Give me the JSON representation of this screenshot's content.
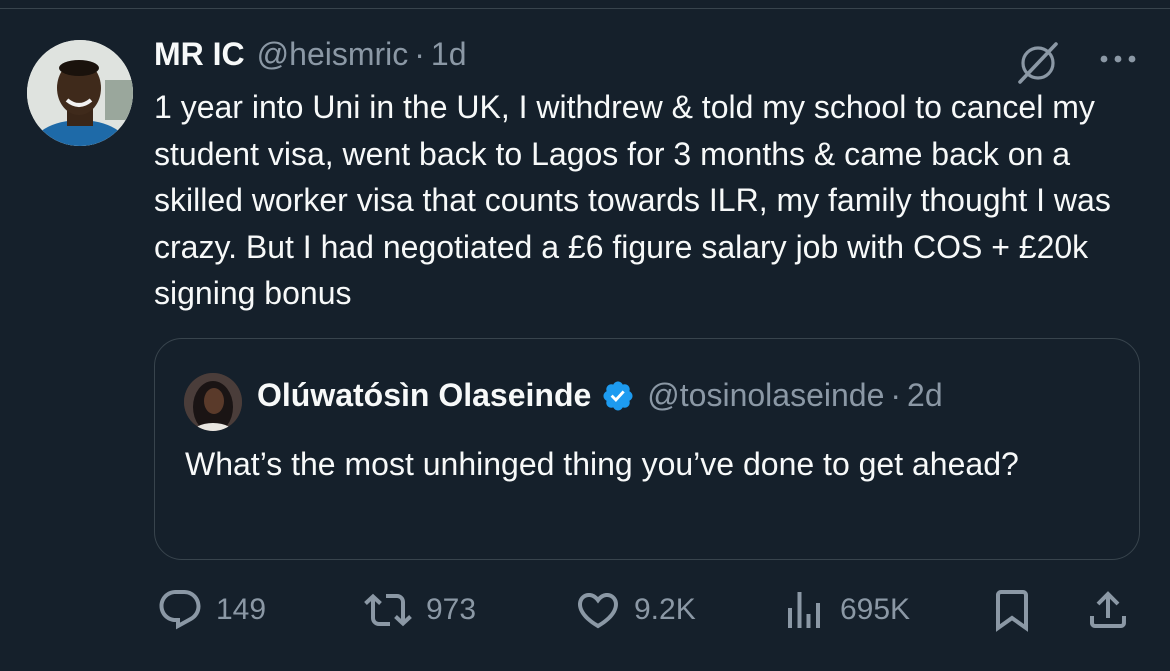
{
  "tweet": {
    "author_name": "MR IC",
    "handle": "@heismric",
    "separator": "·",
    "time": "1d",
    "text": "1 year into Uni in the UK, I withdrew & told my school to cancel my student visa, went back to Lagos for 3 months & came back on a skilled worker visa that counts towards ILR, my family thought I was crazy. But I had negotiated a £6 figure salary job with COS + £20k signing bonus"
  },
  "quote": {
    "author_name": "Olúwatósìn Olaseinde",
    "verified": true,
    "handle": "@tosinolaseinde",
    "separator": "·",
    "time": "2d",
    "text": "What’s the most unhinged thing you’ve done to get ahead?"
  },
  "actions": {
    "replies": "149",
    "reposts": "973",
    "likes": "9.2K",
    "views": "695K"
  },
  "icons": {
    "top_right": [
      "grok-icon",
      "more-icon"
    ],
    "action_bar": [
      "reply-icon",
      "repost-icon",
      "like-icon",
      "views-icon",
      "bookmark-icon",
      "share-icon"
    ]
  },
  "colors": {
    "background": "#15202b",
    "text": "#f7f9f9",
    "secondary": "#8b98a5",
    "border": "#38444d",
    "verified": "#1d9bf0"
  }
}
